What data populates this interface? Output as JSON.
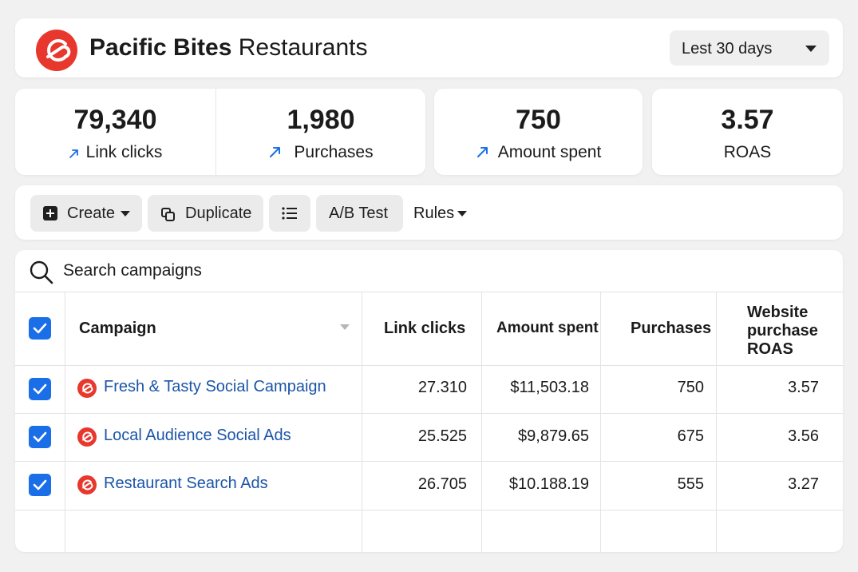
{
  "header": {
    "title_bold": "Pacific Bites",
    "title_rest": "Restaurants",
    "date_range": "Lest 30 days"
  },
  "kpis": {
    "link_clicks": {
      "value": "79,340",
      "label": "Link clicks"
    },
    "purchases": {
      "value": "1,980",
      "label": "Purchases"
    },
    "amount_spent": {
      "value": "750",
      "label": "Amount spent"
    },
    "roas": {
      "value": "3.57",
      "label": "ROAS"
    }
  },
  "toolbar": {
    "create_label": "Create",
    "duplicate_label": "Duplicate",
    "ab_test_label": "A/B Test",
    "rules_label": "Rules"
  },
  "search": {
    "placeholder": "Search campaigns"
  },
  "table": {
    "columns": {
      "campaign": "Campaign",
      "link_clicks": "Link clicks",
      "amount_spent": "Amount spent",
      "purchases": "Purchases",
      "roas_line1": "Website",
      "roas_line2": "purchase",
      "roas_line3": "ROAS"
    },
    "rows": [
      {
        "campaign": "Fresh & Tasty Social Campaign",
        "link_clicks": "27.310",
        "amount_spent": "$11,503.18",
        "purchases": "750",
        "roas": "3.57"
      },
      {
        "campaign": "Local Audience Social Ads",
        "link_clicks": "25.525",
        "amount_spent": "$9,879.65",
        "purchases": "675",
        "roas": "3.56"
      },
      {
        "campaign": "Restaurant Search Ads",
        "link_clicks": "26.705",
        "amount_spent": "$10.188.19",
        "purchases": "555",
        "roas": "3.27"
      }
    ]
  },
  "colors": {
    "brand": "#e8372c",
    "accent": "#1a6fe8",
    "link": "#1b55a8"
  }
}
